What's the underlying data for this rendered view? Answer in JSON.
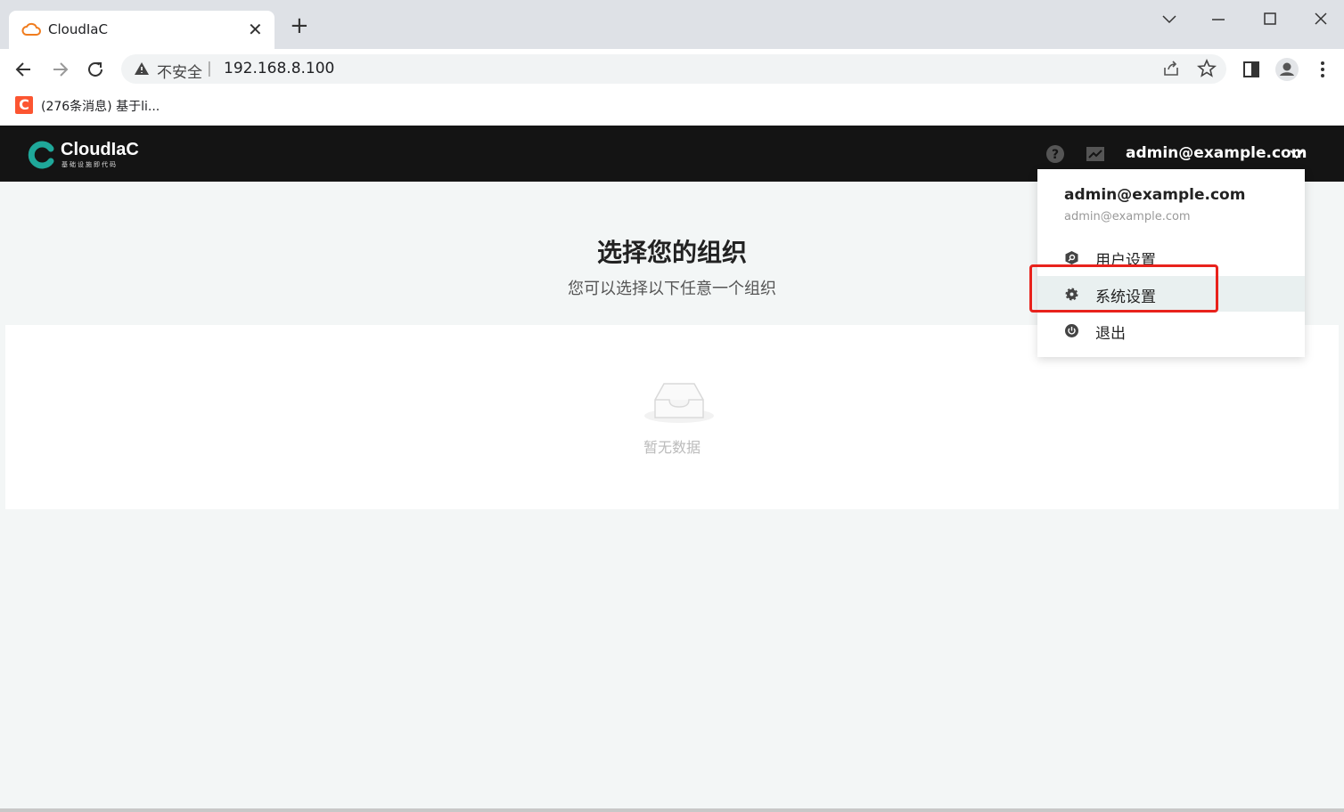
{
  "browser": {
    "tab_title": "CloudIaC",
    "new_tab": "+",
    "close_tab": "✕",
    "insecure_label": "不安全",
    "url": "192.168.8.100",
    "bookmark_icon_letter": "C",
    "bookmark_label": "(276条消息) 基于li..."
  },
  "app": {
    "logo_text": "CloudIaC",
    "logo_subtitle": "基础设施即代码",
    "user": "admin@example.com",
    "page_title": "选择您的组织",
    "page_subtitle": "您可以选择以下任意一个组织",
    "empty_text": "暂无数据",
    "accent_color": "#1fa89a"
  },
  "dropdown": {
    "name": "admin@example.com",
    "email": "admin@example.com",
    "items": [
      {
        "label": "用户设置",
        "icon": "user-settings-icon"
      },
      {
        "label": "系统设置",
        "icon": "gear-icon"
      },
      {
        "label": "退出",
        "icon": "power-icon"
      }
    ]
  }
}
